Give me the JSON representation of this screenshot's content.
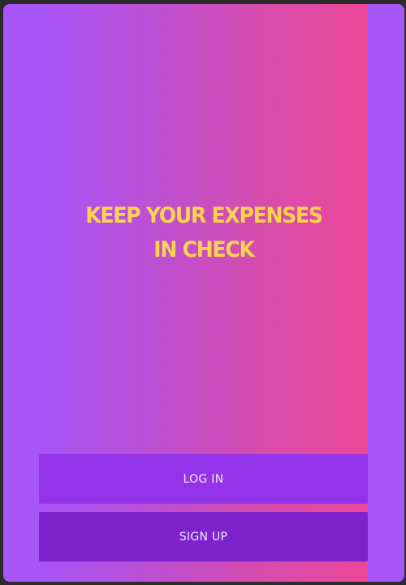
{
  "welcome": {
    "headline_line1": "KEEP YOUR EXPENSES",
    "headline_line2": "IN CHECK"
  },
  "actions": {
    "login_label": "LOG IN",
    "signup_label": "SIGN UP"
  },
  "colors": {
    "gradient_start": "#a855f7",
    "gradient_end": "#ec4899",
    "headline": "#fcd34d",
    "login_button": "#9333ea",
    "signup_button": "#7e22ce",
    "button_text": "#f3e8ff"
  }
}
